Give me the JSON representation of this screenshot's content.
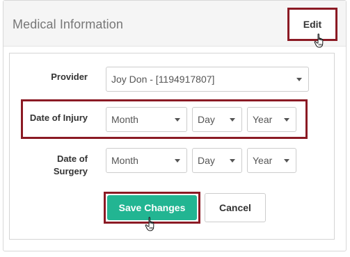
{
  "card": {
    "title": "Medical Information",
    "edit_label": "Edit"
  },
  "form": {
    "provider": {
      "label": "Provider",
      "value": "Joy Don - [1194917807]"
    },
    "date_of_injury": {
      "label": "Date of Injury",
      "month": "Month",
      "day": "Day",
      "year": "Year"
    },
    "date_of_surgery": {
      "label_line1": "Date of",
      "label_line2": "Surgery",
      "month": "Month",
      "day": "Day",
      "year": "Year"
    }
  },
  "actions": {
    "save_label": "Save Changes",
    "cancel_label": "Cancel"
  },
  "colors": {
    "highlight_border": "#8b1a24",
    "save_button": "#22b592"
  },
  "icons": {
    "cursor": "hand-pointer-icon",
    "dropdown": "caret-down-icon"
  }
}
